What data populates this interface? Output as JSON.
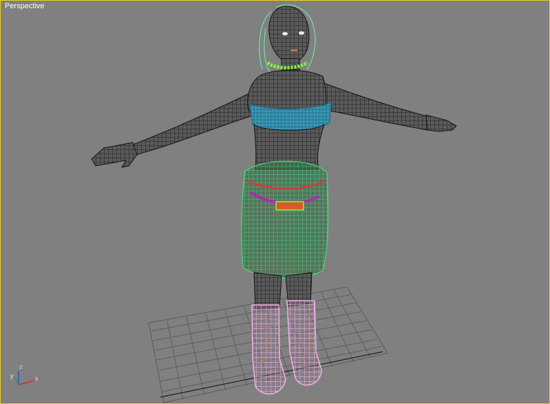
{
  "viewport": {
    "label": "Perspective",
    "border_color": "#e8d21a",
    "background": "#808080"
  },
  "axis_gizmo": {
    "x_label": "x",
    "y_label": "y",
    "z_label": "z",
    "x_color": "#d62828",
    "y_color": "#2aa02a",
    "z_color": "#2a4fd6"
  },
  "scene_objects": [
    {
      "name": "body-mesh",
      "color": "#1e1e1e"
    },
    {
      "name": "top-garment",
      "color": "#3a9fbf"
    },
    {
      "name": "skirt",
      "color": "#3fd46a"
    },
    {
      "name": "boots",
      "color": "#f3b0e8"
    },
    {
      "name": "hair",
      "color": "#6fe3a8"
    },
    {
      "name": "necklace",
      "color": "#7cff3a"
    }
  ]
}
